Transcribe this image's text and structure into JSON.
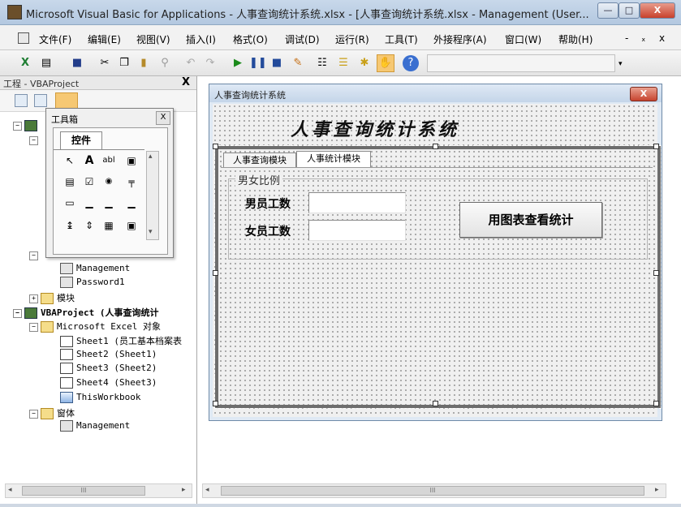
{
  "window": {
    "title": "Microsoft Visual Basic for Applications - 人事查询统计系统.xlsx - [人事查询统计系统.xlsx - Management (User...",
    "min_label": "—",
    "max_label": "□",
    "close_label": "X"
  },
  "menu": {
    "items": [
      "文件(F)",
      "编辑(E)",
      "视图(V)",
      "插入(I)",
      "格式(O)",
      "调试(D)",
      "运行(R)",
      "工具(T)",
      "外接程序(A)",
      "窗口(W)",
      "帮助(H)"
    ],
    "controls": [
      "-",
      "ₓ",
      "x"
    ]
  },
  "toolbar": {
    "icons": [
      "excel-icon",
      "insert-userform-icon",
      "save-icon",
      "cut-icon",
      "copy-icon",
      "paste-icon",
      "find-icon",
      "undo-icon",
      "redo-icon",
      "run-icon",
      "break-icon",
      "reset-icon",
      "design-mode-icon",
      "project-explorer-icon",
      "properties-icon",
      "object-browser-icon",
      "toolbox-icon",
      "help-icon"
    ]
  },
  "project": {
    "title": "工程 - VBAProject",
    "close_label": "X",
    "tree": {
      "management": "Management",
      "password": "Password1",
      "modules": "模块",
      "vbaproject": "VBAProject (人事查询统计",
      "excel_objects": "Microsoft Excel 对象",
      "sheet1": "Sheet1 (员工基本档案表",
      "sheet2": "Sheet2 (Sheet1)",
      "sheet3": "Sheet3 (Sheet2)",
      "sheet4": "Sheet4 (Sheet3)",
      "workbook": "ThisWorkbook",
      "forms": "窗体",
      "form_management": "Management"
    },
    "scroll_label": "III"
  },
  "toolbox": {
    "title": "工具箱",
    "tab": "控件",
    "close_label": "X",
    "tools": [
      "pointer",
      "label",
      "textbox",
      "combobox",
      "listbox",
      "checkbox",
      "optionbutton",
      "togglebutton",
      "frame",
      "commandbutton",
      "tabstrip",
      "multipage",
      "scrollbar",
      "spinbutton",
      "image",
      "refedit"
    ],
    "tool_glyphs": [
      "↖",
      "A",
      "abl",
      "▣",
      "▤",
      "☑",
      "◉",
      "╤",
      "▭",
      "▁",
      "▁",
      "▁",
      "↨",
      "⇕",
      "▦",
      "▣"
    ]
  },
  "form": {
    "title": "人事查询统计系统",
    "close_label": "X",
    "heading": "人事查询统计系统",
    "tabs": [
      "人事查询模块",
      "人事统计模块"
    ],
    "active_tab": 1,
    "frame_caption": "男女比例",
    "male_label": "男员工数",
    "female_label": "女员工数",
    "male_value": "",
    "female_value": "",
    "chart_button": "用图表查看统计"
  },
  "code": {
    "scroll_label": "III"
  }
}
